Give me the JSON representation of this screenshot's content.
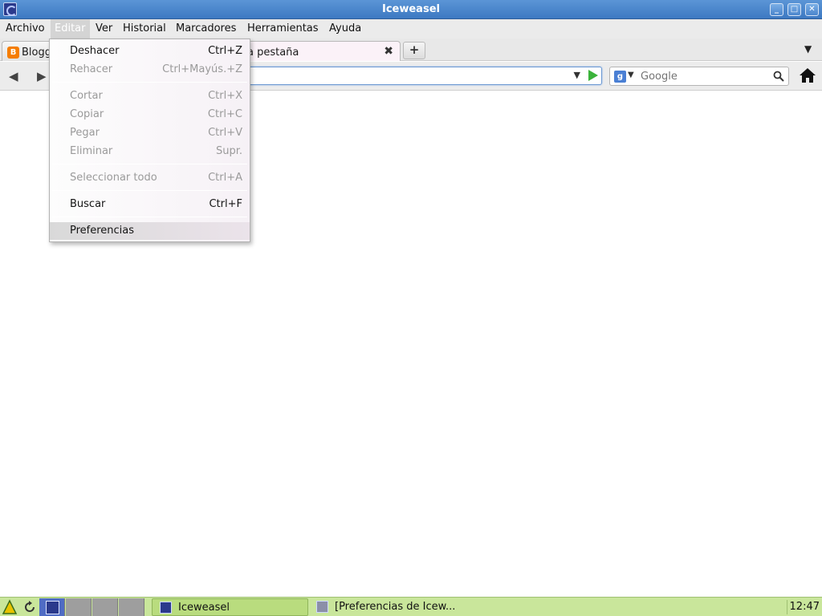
{
  "window": {
    "title": "Iceweasel"
  },
  "menubar": {
    "items": [
      "Archivo",
      "Editar",
      "Ver",
      "Historial",
      "Marcadores",
      "Herramientas",
      "Ayuda"
    ],
    "active": "Editar"
  },
  "tabs": [
    {
      "label": "Blogg",
      "favicon": "blogger-icon"
    },
    {
      "label": "a pestaña"
    }
  ],
  "search": {
    "engine_icon": "google-icon",
    "placeholder": "Google"
  },
  "edit_menu": {
    "items": [
      {
        "label": "Deshacer",
        "shortcut": "Ctrl+Z",
        "enabled": true
      },
      {
        "label": "Rehacer",
        "shortcut": "Ctrl+Mayús.+Z",
        "enabled": false
      },
      {
        "label": "Cortar",
        "shortcut": "Ctrl+X",
        "enabled": false
      },
      {
        "label": "Copiar",
        "shortcut": "Ctrl+C",
        "enabled": false
      },
      {
        "label": "Pegar",
        "shortcut": "Ctrl+V",
        "enabled": false
      },
      {
        "label": "Eliminar",
        "shortcut": "Supr.",
        "enabled": false
      },
      {
        "label": "Seleccionar todo",
        "shortcut": "Ctrl+A",
        "enabled": false
      },
      {
        "label": "Buscar",
        "shortcut": "Ctrl+F",
        "enabled": true
      },
      {
        "label": "Preferencias",
        "shortcut": "",
        "enabled": true,
        "highlighted": true
      }
    ]
  },
  "taskbar": {
    "tasks": [
      {
        "label": "Iceweasel",
        "active": true
      },
      {
        "label": "[Preferencias de Icew...",
        "active": false
      }
    ],
    "clock": "12:47"
  },
  "colors": {
    "titlebar": "#4a86cc",
    "taskbar": "#c9e69b",
    "go_arrow": "#3bb33b",
    "favicon_blogger": "#f57d00"
  }
}
